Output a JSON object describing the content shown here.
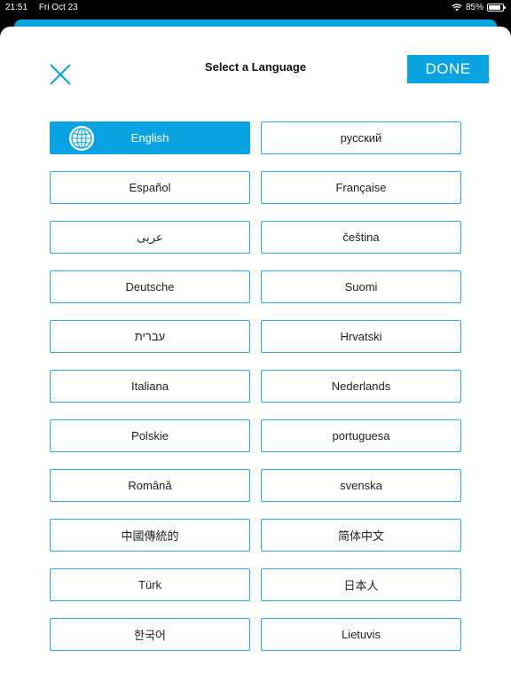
{
  "status_bar": {
    "time": "21:51",
    "date": "Fri Oct 23",
    "battery": "85%",
    "battery_level": 0.85
  },
  "header": {
    "title": "Select a Language",
    "done_label": "DONE"
  },
  "languages": [
    "English",
    "русский",
    "Español",
    "Française",
    "عربى",
    "čeština",
    "Deutsche",
    "Suomi",
    "עברית",
    "Hrvatski",
    "Italiana",
    "Nederlands",
    "Polskie",
    "portuguesa",
    "Română",
    "svenska",
    "中國傳統的",
    "简体中文",
    "Türk",
    "日本人",
    "한국어",
    "Lietuvis"
  ],
  "selected_language": "English",
  "colors": {
    "accent": "#0aa3e2",
    "border": "#2aa9df"
  }
}
